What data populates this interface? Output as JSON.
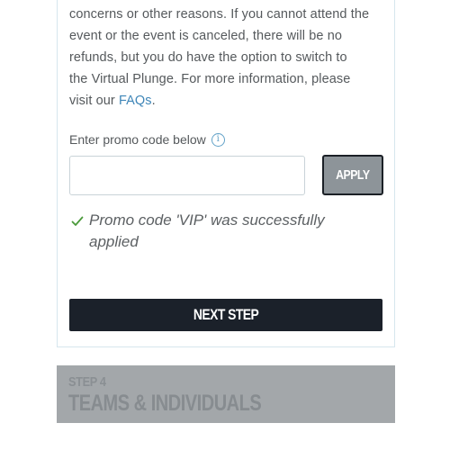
{
  "info_paragraph": {
    "lines": [
      "concerns or other reasons. If you cannot attend the",
      "event or the event is canceled, there will be no",
      "refunds, but you do have the option to switch to",
      "the Virtual Plunge. For more information, please"
    ],
    "last_line_prefix": "visit our ",
    "faq_link_text": "FAQs",
    "last_line_suffix": "."
  },
  "promo": {
    "label": "Enter promo code below",
    "input_value": "",
    "input_placeholder": "",
    "apply_label": "APPLY",
    "success_message": "Promo code 'VIP' was successfully applied"
  },
  "next_button_label": "NEXT STEP",
  "next_step": {
    "number_label": "STEP 4",
    "title": "TEAMS & INDIVIDUALS"
  },
  "icons": {
    "info": "info-icon",
    "success": "check-icon"
  },
  "colors": {
    "link": "#3f86b8",
    "success_check": "#4a9a3a",
    "primary_button": "#1b212a",
    "apply_button": "#8d9499",
    "disabled_step": "#a3a7aa"
  }
}
